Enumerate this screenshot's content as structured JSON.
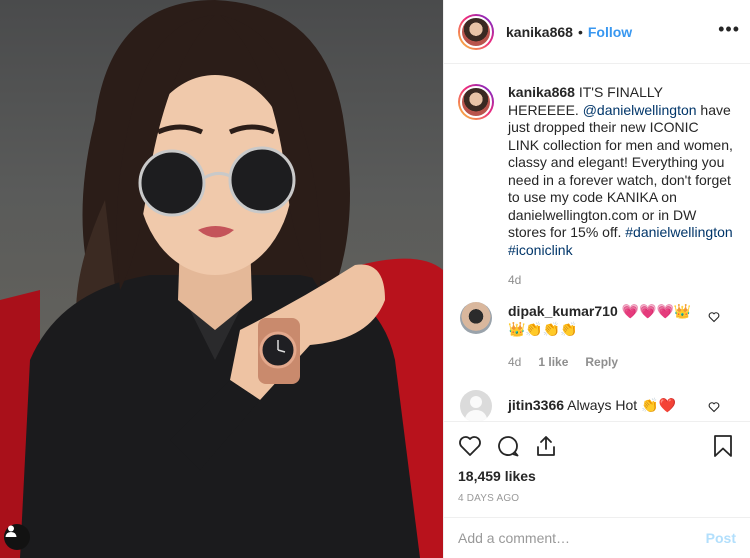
{
  "post": {
    "username": "kanika868",
    "follow_label": "Follow",
    "separator": "•",
    "more_label": "•••"
  },
  "caption": {
    "username": "kanika868",
    "text_before": " IT'S FINALLY HEREEEE. ",
    "mention": "@danielwellington",
    "text_after": " have just dropped their new ICONIC LINK collection for men and women, classy and elegant! Everything you need in a forever watch, don't forget to use my code KANIKA on danielwellington.com or in DW stores for 15% off. ",
    "hashtag1": "#danielwellington",
    "hashtag2": "#iconiclink",
    "time": "4d"
  },
  "comments": [
    {
      "username": "dipak_kumar710",
      "text": " 💗💗💗👑 👑👏👏👏",
      "time": "4d",
      "likes": "1 like",
      "reply_label": "Reply"
    },
    {
      "username": "jitin3366",
      "text": " Always Hot 👏❤️"
    }
  ],
  "stats": {
    "likes": "18,459 likes",
    "date": "4 DAYS AGO"
  },
  "composer": {
    "placeholder": "Add a comment…",
    "post_label": "Post"
  },
  "colors": {
    "accent": "#3897f0",
    "link": "#003569",
    "muted": "#8e8e8e",
    "post_disabled": "#b2dffc"
  }
}
